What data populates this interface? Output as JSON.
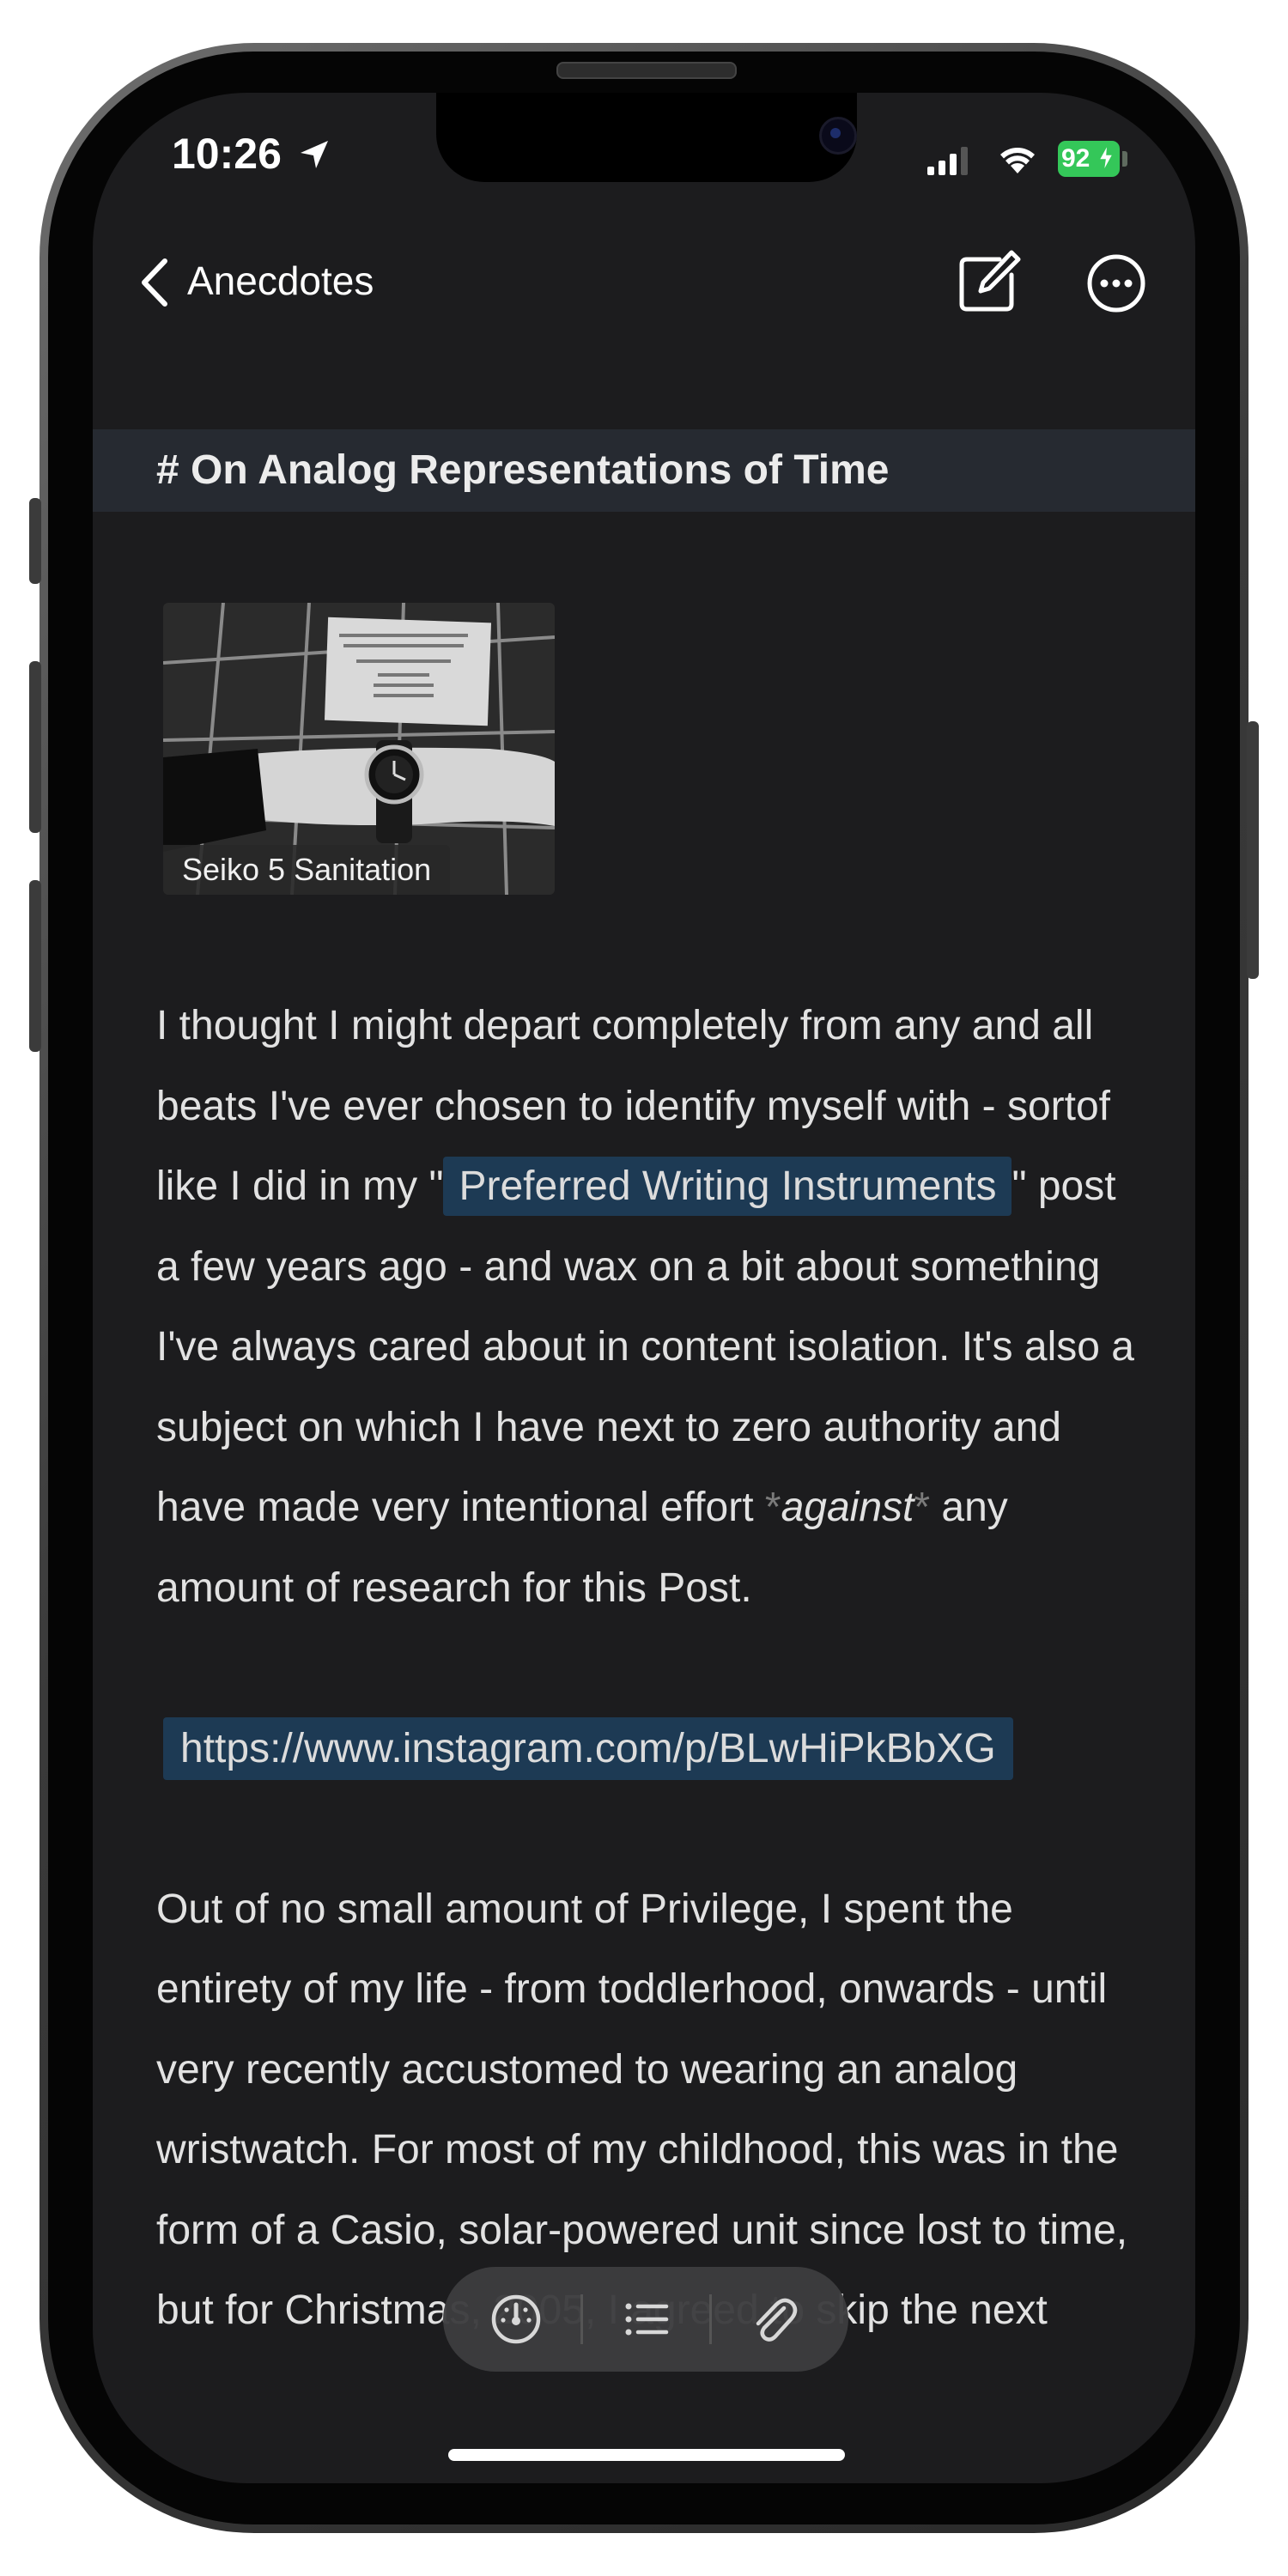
{
  "status_bar": {
    "time": "10:26",
    "battery": "92",
    "battery_color": "#34c759"
  },
  "nav": {
    "back_label": "Anecdotes",
    "icons": [
      "chevron-back-icon",
      "compose-icon",
      "more-icon"
    ]
  },
  "note": {
    "heading": "# On Analog Representations of Time",
    "image_caption": "Seiko 5 Sanitation",
    "para1": {
      "text_a": "I thought I might depart completely from any and all beats I've ever chosen to identify myself with - sortof like I did in my \"",
      "link": "Preferred Writing Instruments",
      "text_b": "\" post a few years ago - and wax on a bit about something I've always cared about in content isolation. It's also a subject on which I have next to zero authority and have made very intentional effort ",
      "emph_marker_open": "*",
      "emph": "against",
      "emph_marker_close": "*",
      "text_c": " any amount of research for this Post."
    },
    "url": "https://www.instagram.com/p/BLwHiPkBbXG",
    "para2": "Out of no small amount of Privilege, I spent the entirety of my life - from toddlerhood, onwards - until very recently accustomed to wearing an analog wristwatch. For most of my childhood, this was in the form of a Casio, solar-powered unit since lost to time, but for Christmas, 2005, I agreed to skip the next"
  },
  "toolbar": {
    "icons": [
      "gauge-icon",
      "list-icon",
      "paperclip-icon"
    ]
  },
  "colors": {
    "background": "#1c1c1e",
    "heading_band": "#262a31",
    "link_highlight": "#1d3a54",
    "toolbar": "#3c3c3e"
  }
}
